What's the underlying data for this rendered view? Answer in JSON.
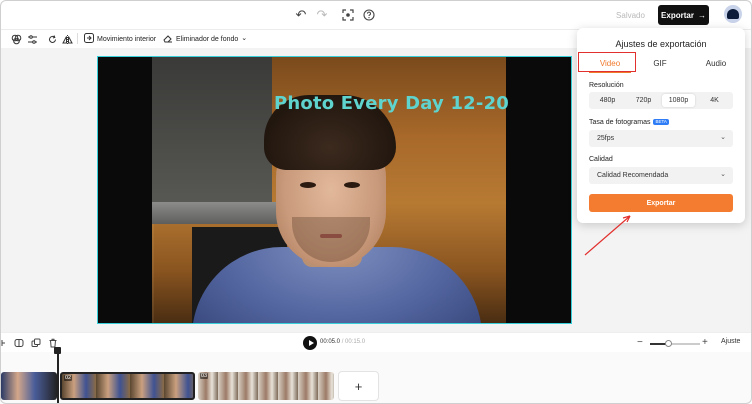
{
  "header": {
    "saved_label": "Salvado",
    "export_label": "Exportar",
    "export_arrow": "→",
    "undo_icon": "↶",
    "redo_icon": "↷"
  },
  "toolbar": {
    "motion_label": "Movimiento interior",
    "bg_remover_label": "Eliminador de fondo",
    "dropdown_caret": "⌄"
  },
  "video": {
    "title_overlay": "Photo Every Day 12-20"
  },
  "export_panel": {
    "title": "Ajustes de exportación",
    "tabs": [
      {
        "label": "Video",
        "active": true
      },
      {
        "label": "GIF",
        "active": false
      },
      {
        "label": "Audio",
        "active": false
      }
    ],
    "resolution_label": "Resolución",
    "resolution_options": [
      "480p",
      "720p",
      "1080p",
      "4K"
    ],
    "resolution_selected": "1080p",
    "fps_label": "Tasa de fotogramas",
    "beta_badge": "BETA",
    "fps_value": "25fps",
    "quality_label": "Calidad",
    "quality_value": "Calidad Recomendada",
    "export_button": "Exportar"
  },
  "timeline": {
    "current_time": "00:05.0",
    "separator": " / ",
    "total_time": "00:15.0",
    "fit_label": "Ajuste",
    "zoom_level": 0.35,
    "clips": [
      {
        "number": ""
      },
      {
        "number": "02"
      },
      {
        "number": "03"
      }
    ],
    "add_clip_icon": "+"
  },
  "colors": {
    "accent": "#f47c30",
    "selection_border": "#37d0da",
    "annotation_red": "#e2302e",
    "title_text": "#5fd4cf"
  }
}
